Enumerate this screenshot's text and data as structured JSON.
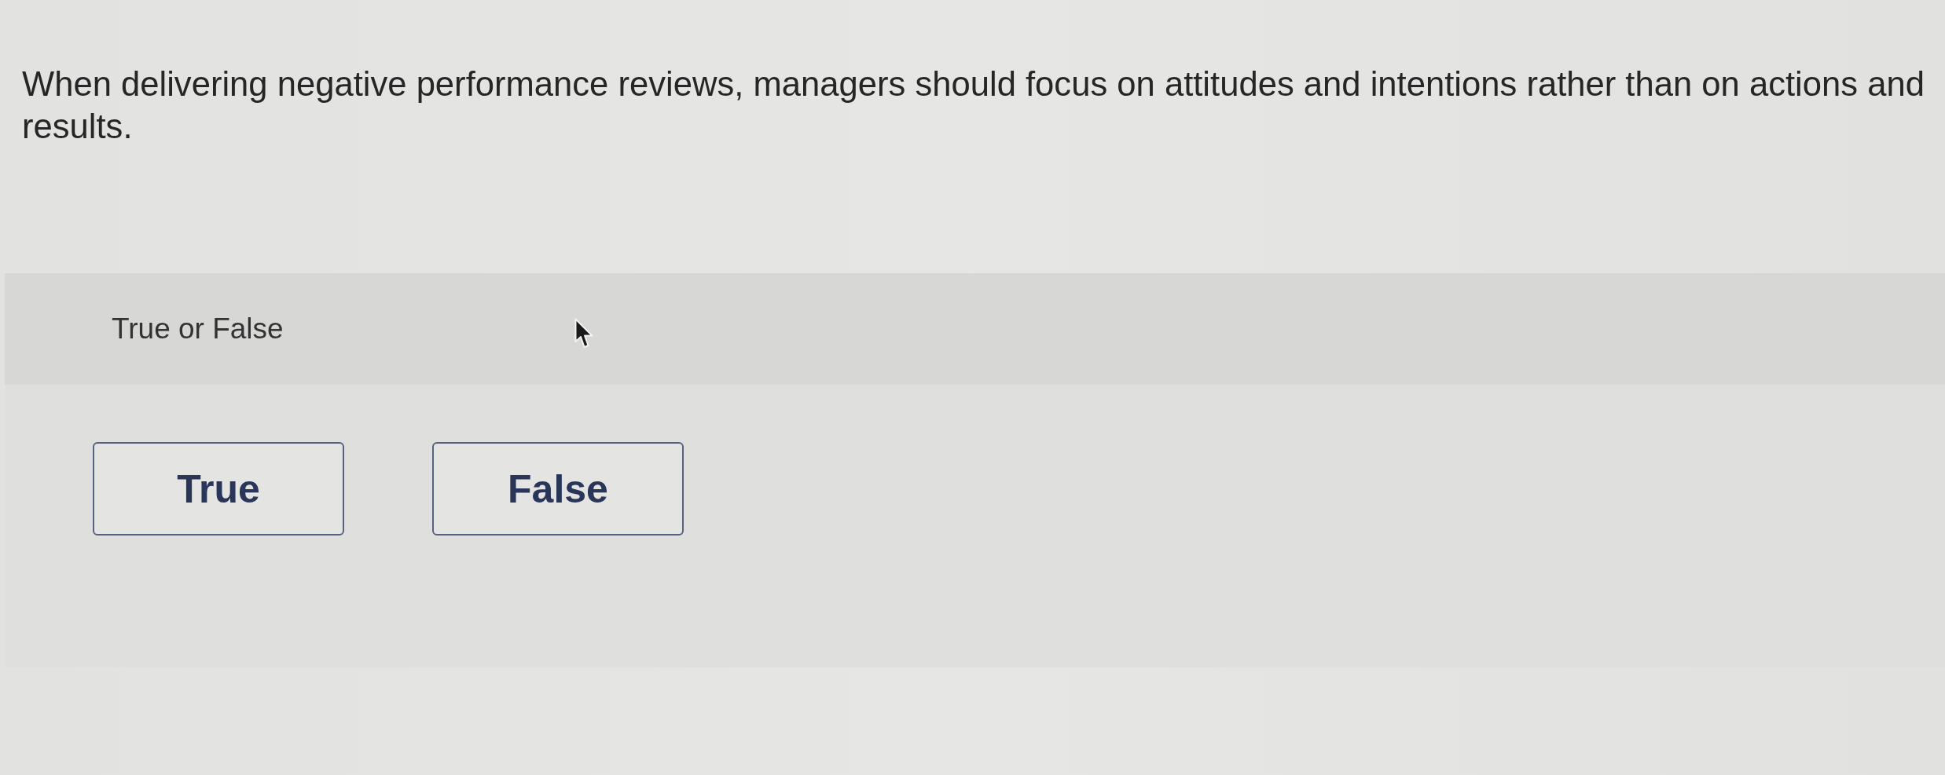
{
  "question": {
    "text": "When delivering negative performance reviews, managers should focus on attitudes and intentions rather than on actions and results."
  },
  "prompt": {
    "label": "True or False"
  },
  "options": [
    {
      "label": "True",
      "selected": false
    },
    {
      "label": "False",
      "selected": false
    }
  ]
}
